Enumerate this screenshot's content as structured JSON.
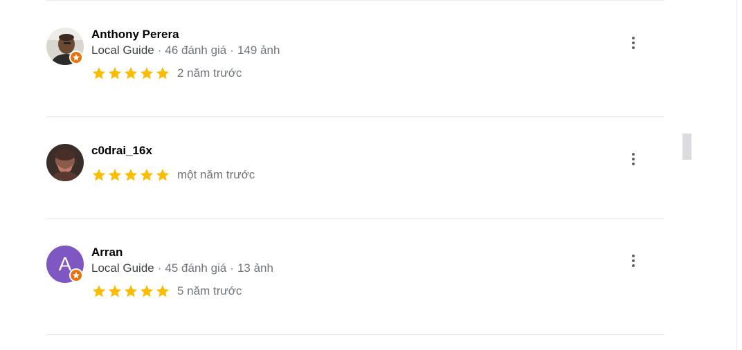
{
  "reviews": [
    {
      "author": "Anthony Perera",
      "guide_label": "Local Guide",
      "reviews_count": "46 đánh giá",
      "photos_count": "149 ảnh",
      "rating": 5,
      "time": "2 năm trước"
    },
    {
      "author": "c0drai_16x",
      "rating": 5,
      "time": "một năm trước"
    },
    {
      "author": "Arran",
      "avatar_letter": "A",
      "avatar_color": "#7e57c2",
      "guide_label": "Local Guide",
      "reviews_count": "45 đánh giá",
      "photos_count": "13 ảnh",
      "rating": 5,
      "time": "5 năm trước"
    }
  ],
  "colors": {
    "star": "#fbbc04",
    "badge": "#e8710a",
    "meta_text": "#70757a",
    "divider": "#e8eaed"
  },
  "icons": {
    "more_actions": "more-vert-icon",
    "local_guide_badge": "local-guide-star-icon",
    "rating_star": "star-icon"
  },
  "separator": "·"
}
